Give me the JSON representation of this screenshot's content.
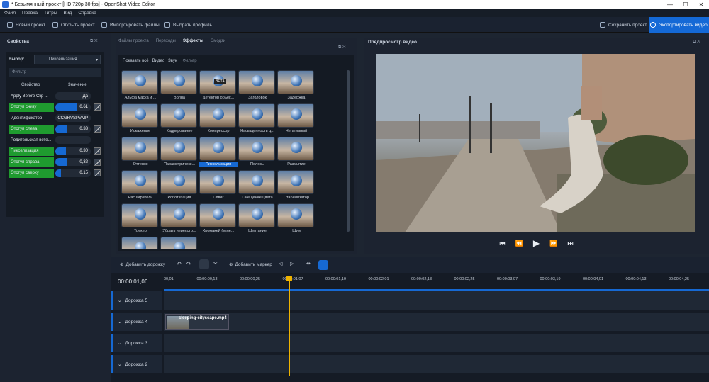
{
  "window": {
    "title": "* Безымянный проект [HD 720p 30 fps] - OpenShot Video Editor",
    "minimize": "—",
    "maximize": "☐",
    "close": "✕"
  },
  "menu": [
    "Файл",
    "Правка",
    "Титры",
    "Вид",
    "Справка"
  ],
  "toolbar": {
    "new_project": "Новый проект",
    "open_project": "Открыть проект",
    "import_files": "Импортировать файлы",
    "choose_profile": "Выбрать профиль",
    "save_project": "Сохранить проект",
    "export_video": "Экспортировать видео"
  },
  "properties": {
    "title": "Свойства",
    "selection_label": "Выбор:",
    "selection_value": "Пикселизация",
    "filter_placeholder": "Фильтр",
    "col_property": "Свойство",
    "col_value": "Значение",
    "rows": [
      {
        "name": "Apply Before Clip ...",
        "value": "Да",
        "fill": 0,
        "green": false
      },
      {
        "name": "Отступ снизу",
        "value": "0,61",
        "fill": 0.61,
        "green": true
      },
      {
        "name": "Идентификатор",
        "value": "CCGHVSPVMP",
        "fill": 0,
        "green": false
      },
      {
        "name": "Отступ слева",
        "value": "0,33",
        "fill": 0.33,
        "green": true
      },
      {
        "name": "Родительская вете...",
        "value": "",
        "fill": 0,
        "green": false
      },
      {
        "name": "Пикселизация",
        "value": "0,30",
        "fill": 0.3,
        "green": true
      },
      {
        "name": "Отступ справа",
        "value": "0,32",
        "fill": 0.32,
        "green": true
      },
      {
        "name": "Отступ сверху",
        "value": "0,15",
        "fill": 0.15,
        "green": true
      }
    ]
  },
  "effects_panel": {
    "tabs": [
      "Файлы проекта",
      "Переходы",
      "Эффекты",
      "Эмодзи"
    ],
    "filters": [
      "Показать всё",
      "Видео",
      "Звук"
    ],
    "filter_placeholder": "Фильтр",
    "items": [
      "Альфа маска и ...",
      "Волна",
      "Детектор объек...",
      "Заголовок",
      "Задержка",
      "Искажение",
      "Кадрирование",
      "Компрессор",
      "Насыщенность ц...",
      "Негативный",
      "Оттенок",
      "Параметрическ...",
      "Пикселизация",
      "Полосы",
      "Размытие",
      "Расширитель",
      "Роботизация",
      "Сдвиг",
      "Смещение цвета",
      "Стабилизатор",
      "Трекер",
      "Убрать чересстр...",
      "Хромакей (зеле...",
      "Шептание",
      "Шум"
    ],
    "selected": "Пикселизация",
    "beta_badge": "BETA"
  },
  "preview": {
    "title": "Предпросмотр видео",
    "controls": [
      "⏮",
      "⏪",
      "▶",
      "⏩",
      "⏭"
    ]
  },
  "timeline": {
    "add_track": "Добавить дорожку",
    "add_marker": "Добавить маркер",
    "timecode": "00:00:01,06",
    "ticks": [
      "00,01",
      "00:00:00,13",
      "00:00:00,25",
      "00:00:01,07",
      "00:00:01,19",
      "00:00:02,01",
      "00:00:02,13",
      "00:00:02,25",
      "00:00:03,07",
      "00:00:03,19",
      "00:00:04,01",
      "00:00:04,13",
      "00:00:04,25"
    ],
    "tracks": [
      "Дорожка 5",
      "Дорожка 4",
      "Дорожка 3",
      "Дорожка 2"
    ],
    "clip_name": "sleeping-cityscape.mp4",
    "accent": "#1669d3",
    "playhead_color": "#f0b400"
  }
}
